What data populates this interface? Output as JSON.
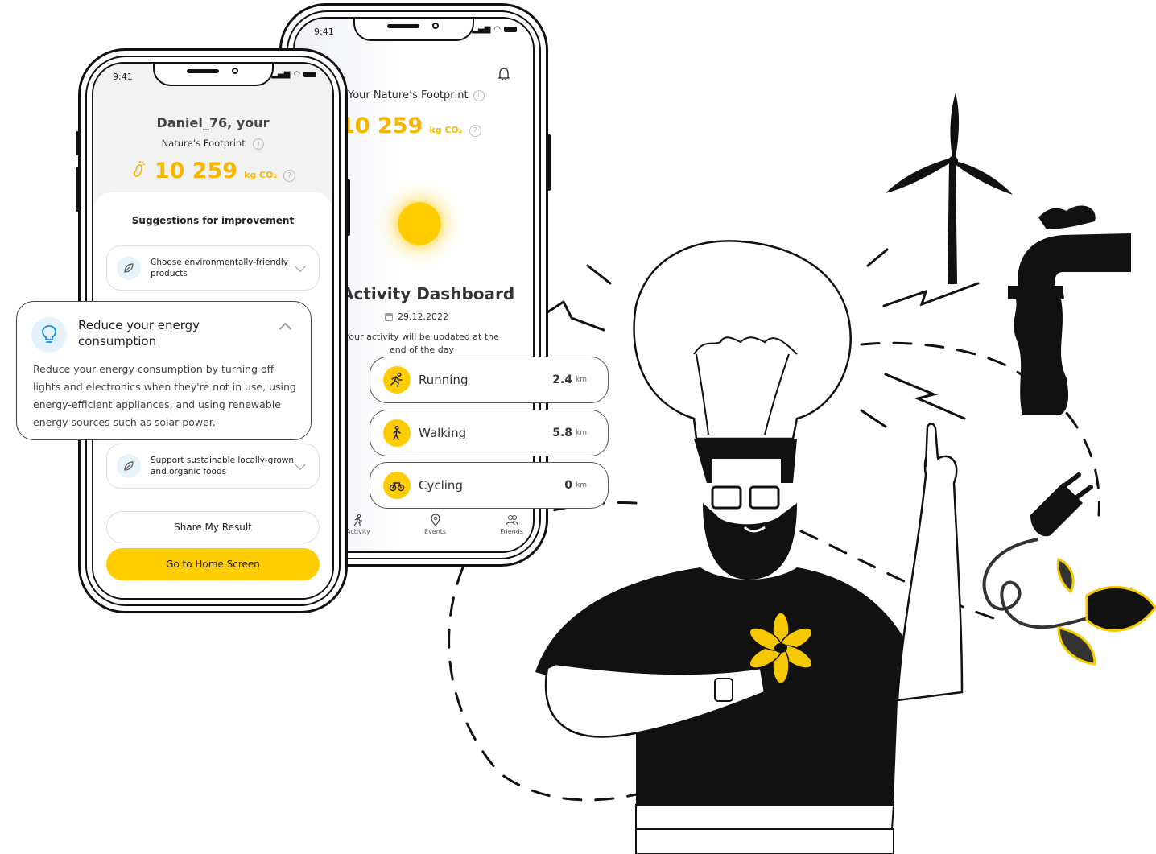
{
  "status_bar": {
    "time": "9:41"
  },
  "back_phone": {
    "title": "Your Nature’s Footprint",
    "score": "10 259",
    "unit": "kg CO₂",
    "dashboard_title": "Activity Dashboard",
    "date": "29.12.2022",
    "note": "Your activity will be updated at the end of the day",
    "activities": [
      {
        "label": "Running",
        "value": "2.4",
        "unit": "km",
        "icon": "running-icon"
      },
      {
        "label": "Walking",
        "value": "5.8",
        "unit": "km",
        "icon": "walking-icon"
      },
      {
        "label": "Cycling",
        "value": "0",
        "unit": "km",
        "icon": "cycling-icon"
      }
    ],
    "tabs": [
      {
        "label": "Activity",
        "icon": "activity-icon"
      },
      {
        "label": "Events",
        "icon": "location-pin-icon"
      },
      {
        "label": "Friends",
        "icon": "friends-icon"
      }
    ]
  },
  "front_phone": {
    "greeting": "Daniel_76, your",
    "subtitle": "Nature’s Footprint",
    "score": "10 259",
    "unit": "kg CO₂",
    "suggestions_title": "Suggestions for improvement",
    "suggestions": [
      {
        "label": "Choose environmentally-friendly products",
        "icon": "leaf-icon"
      },
      {
        "label": "Support sustainable locally-grown and organic foods",
        "icon": "leaf-icon"
      }
    ],
    "share_button": "Share My Result",
    "home_button": "Go to Home Screen"
  },
  "expanded_suggestion": {
    "title": "Reduce your energy consumption",
    "body": "Reduce your energy consumption by turning off lights and electronics when they're not in use, using energy-efficient appliances, and using renewable energy sources such as solar power.",
    "icon": "lightbulb-icon"
  },
  "colors": {
    "accent": "#ffcc00",
    "score": "#f7b500",
    "icon_bg": "#e3f2fc"
  }
}
